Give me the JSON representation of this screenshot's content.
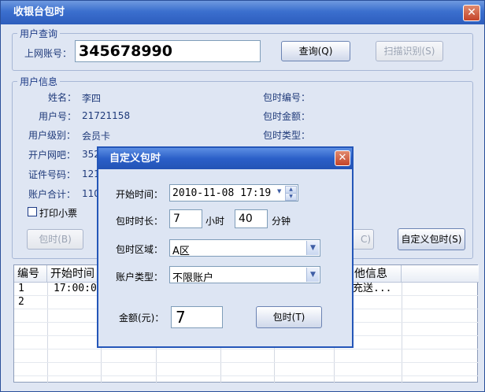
{
  "window": {
    "title": "收银台包时",
    "close": "✕"
  },
  "query_group": {
    "legend": "用户查询",
    "account_label": "上网账号：",
    "account_value": "345678990",
    "query_button": "查询(Q)",
    "scan_button": "扫描识别(S)"
  },
  "info_group": {
    "legend": "用户信息",
    "left": [
      {
        "label": "姓名：",
        "value": "李四"
      },
      {
        "label": "用户号：",
        "value": "21721158"
      },
      {
        "label": "用户级别：",
        "value": "会员卡"
      },
      {
        "label": "开户网吧：",
        "value": "352"
      },
      {
        "label": "证件号码：",
        "value": "121"
      },
      {
        "label": "账户合计：",
        "value": "110"
      }
    ],
    "right": [
      {
        "label": "包时编号：",
        "value": ""
      },
      {
        "label": "包时金额：",
        "value": ""
      },
      {
        "label": "包时类型：",
        "value": ""
      }
    ],
    "print_label": "打印小票",
    "print_checked": false,
    "pack_button": "包时(B)",
    "hidden_button_tail": "C)",
    "custom_button": "自定义包时(S)"
  },
  "grid": {
    "columns": [
      "编号",
      "开始时间",
      "他信息"
    ],
    "rows": [
      {
        "id": "1",
        "start": "17:00:0",
        "info": "充送..."
      },
      {
        "id": "2",
        "start": "",
        "info": ""
      }
    ]
  },
  "dialog": {
    "title": "自定义包时",
    "close": "✕",
    "start_label": "开始时间：",
    "start_value": "2010-11-08 17:19",
    "duration_label": "包时时长：",
    "hours_value": "7",
    "hours_unit": "小时",
    "minutes_value": "40",
    "minutes_unit": "分钟",
    "area_label": "包时区域：",
    "area_value": "A区",
    "account_type_label": "账户类型：",
    "account_type_value": "不限账户",
    "amount_label": "金额(元)：",
    "amount_value": "7",
    "submit_button": "包时(T)"
  }
}
